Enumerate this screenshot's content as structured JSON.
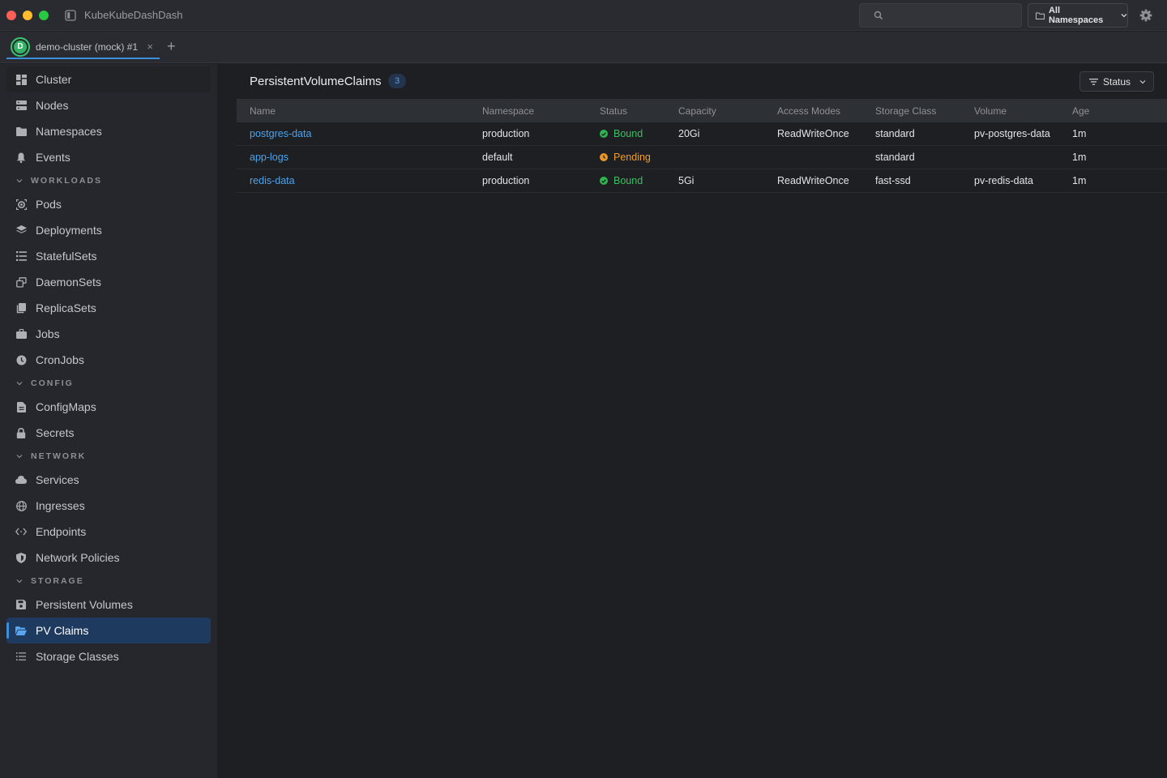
{
  "app": {
    "title": "KubeKubeDashDash"
  },
  "header": {
    "search": {
      "placeholder": ""
    },
    "namespace_select": "All Namespaces"
  },
  "tabs": [
    {
      "avatar": "D",
      "label": "demo-cluster (mock) #1",
      "close": "×"
    }
  ],
  "tab_add": "+",
  "sidebar": {
    "top_items": [
      {
        "label": "Cluster",
        "icon": "grid-icon"
      },
      {
        "label": "Nodes",
        "icon": "server-icon"
      },
      {
        "label": "Namespaces",
        "icon": "folder-icon"
      },
      {
        "label": "Events",
        "icon": "bell-icon"
      }
    ],
    "sections": {
      "workloads": {
        "title": "WORKLOADS",
        "items": [
          {
            "label": "Pods",
            "icon": "pod-icon"
          },
          {
            "label": "Deployments",
            "icon": "layers-icon"
          },
          {
            "label": "StatefulSets",
            "icon": "list-icon"
          },
          {
            "label": "DaemonSets",
            "icon": "copy-icon"
          },
          {
            "label": "ReplicaSets",
            "icon": "stack-icon"
          },
          {
            "label": "Jobs",
            "icon": "briefcase-icon"
          },
          {
            "label": "CronJobs",
            "icon": "clock-icon"
          }
        ]
      },
      "config": {
        "title": "CONFIG",
        "items": [
          {
            "label": "ConfigMaps",
            "icon": "file-icon"
          },
          {
            "label": "Secrets",
            "icon": "lock-icon"
          }
        ]
      },
      "network": {
        "title": "NETWORK",
        "items": [
          {
            "label": "Services",
            "icon": "cloud-icon"
          },
          {
            "label": "Ingresses",
            "icon": "globe-icon"
          },
          {
            "label": "Endpoints",
            "icon": "code-icon"
          },
          {
            "label": "Network Policies",
            "icon": "shield-icon"
          }
        ]
      },
      "storage": {
        "title": "STORAGE",
        "items": [
          {
            "label": "Persistent Volumes",
            "icon": "disk-icon"
          },
          {
            "label": "PV Claims",
            "icon": "folder-open-icon",
            "active": true
          },
          {
            "label": "Storage Classes",
            "icon": "list-icon"
          }
        ]
      }
    }
  },
  "main": {
    "title": "PersistentVolumeClaims",
    "count": "3",
    "status_filter": "Status",
    "columns": [
      "Name",
      "Namespace",
      "Status",
      "Capacity",
      "Access Modes",
      "Storage Class",
      "Volume",
      "Age"
    ],
    "rows": [
      {
        "name": "postgres-data",
        "namespace": "production",
        "status": "Bound",
        "capacity": "20Gi",
        "access_modes": "ReadWriteOnce",
        "storage_class": "standard",
        "volume": "pv-postgres-data",
        "age": "1m"
      },
      {
        "name": "app-logs",
        "namespace": "default",
        "status": "Pending",
        "capacity": "",
        "access_modes": "",
        "storage_class": "standard",
        "volume": "",
        "age": "1m"
      },
      {
        "name": "redis-data",
        "namespace": "production",
        "status": "Bound",
        "capacity": "5Gi",
        "access_modes": "ReadWriteOnce",
        "storage_class": "fast-ssd",
        "volume": "pv-redis-data",
        "age": "1m"
      }
    ]
  },
  "colors": {
    "accent": "#3d8ed8",
    "link": "#4ba3ee",
    "bound": "#39c25f",
    "pending": "#ee9d2b",
    "active_nav_bg": "#1e3a5e"
  }
}
